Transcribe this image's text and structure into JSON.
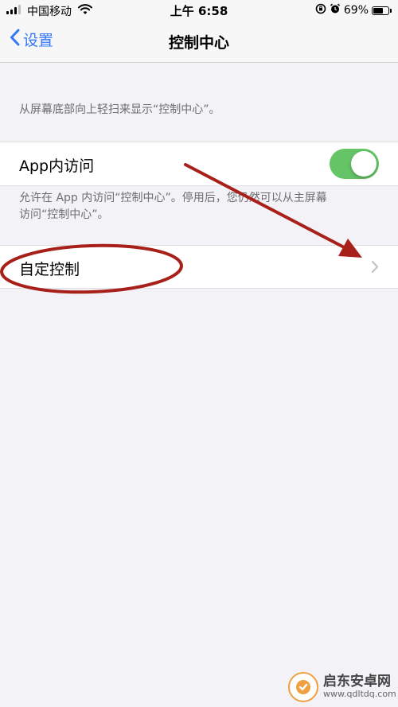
{
  "status_bar": {
    "carrier": "中国移动",
    "time": "上午 6:58",
    "battery": "69%",
    "battery_level": 0.69,
    "icons": [
      "signal-icon",
      "wifi-icon",
      "orientation-lock-icon",
      "alarm-icon",
      "battery-icon"
    ]
  },
  "nav": {
    "back_label": "设置",
    "title": "控制中心"
  },
  "content": {
    "top_description": "从屏幕底部向上轻扫来显示“控制中心”。",
    "in_app_access": {
      "label": "App内访问",
      "toggle_on": true
    },
    "in_app_description_line1": "允许在 App 内访问“控制中心”。停用后，您仍然可以从主屏幕",
    "in_app_description_line2": "访问“控制中心”。",
    "customize_label": "自定控制"
  },
  "watermark": {
    "name": "启东安卓网",
    "url": "www.qdltdq.com"
  },
  "colors": {
    "accent": "#3478f6",
    "toggle_on": "#65c466",
    "annotation": "#a8201a",
    "background": "#f2f2f7"
  }
}
